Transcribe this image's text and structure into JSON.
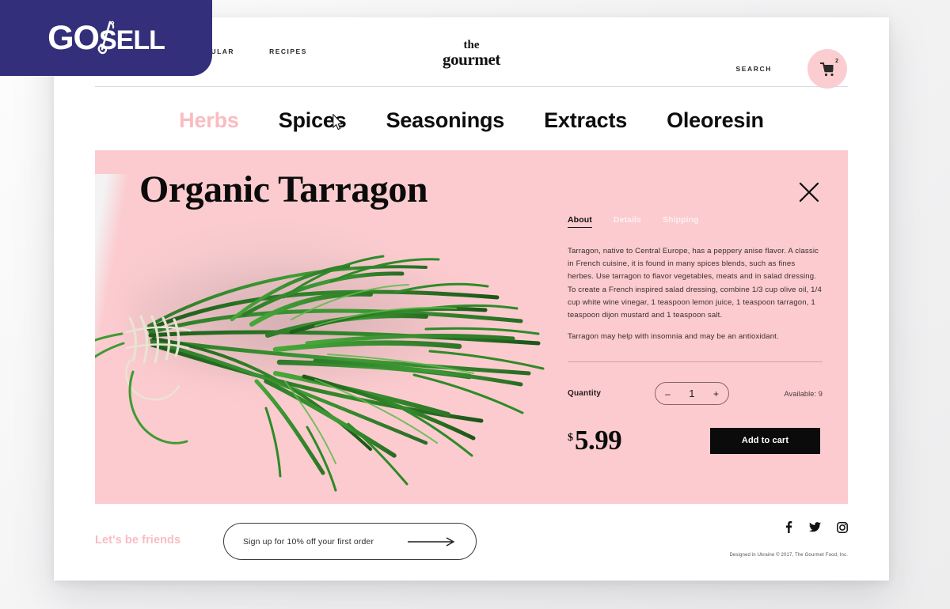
{
  "badge": {
    "text_go": "G",
    "text_o": "O",
    "text_sell": "SELL",
    "full": "GoSELL"
  },
  "header": {
    "nav_items": [
      "POPULAR",
      "RECIPES"
    ],
    "brand_line1": "the",
    "brand_line2": "gourmet",
    "search_label": "SEARCH",
    "cart_icon": "shopping-cart-icon",
    "cart_count": "2"
  },
  "categories": [
    {
      "label": "Herbs",
      "active": true
    },
    {
      "label": "Spices",
      "active": false
    },
    {
      "label": "Seasonings",
      "active": false
    },
    {
      "label": "Extracts",
      "active": false
    },
    {
      "label": "Oleoresin",
      "active": false
    }
  ],
  "product": {
    "title": "Organic Tarragon",
    "close_icon": "close-icon",
    "image_alt": "organic tarragon bunch tied with twine",
    "tabs": [
      {
        "label": "About",
        "active": true
      },
      {
        "label": "Details",
        "active": false
      },
      {
        "label": "Shipping",
        "active": false
      }
    ],
    "description_p1": "Tarragon, native to Central Europe, has a peppery anise flavor. A classic in French cuisine, it is found in many spices blends, such as fines herbes. Use tarragon to flavor vegetables, meats and in salad dressing. To create a French inspired salad dressing, combine 1/3 cup olive oil, 1/4 cup white wine vinegar, 1 teaspoon lemon juice, 1 teaspoon tarragon, 1 teaspoon dijon mustard and 1 teaspoon salt.",
    "description_p2": "Tarragon may help with insomnia and may be an antioxidant.",
    "quantity_label": "Quantity",
    "quantity_minus": "–",
    "quantity_value": "1",
    "quantity_plus": "+",
    "availability": "Available: 9",
    "price_currency": "$",
    "price_amount": "5.99",
    "add_to_cart_label": "Add to cart"
  },
  "footer": {
    "friends_label": "Let's be friends",
    "signup_text": "Sign up for 10% off your first order",
    "signup_arrow_icon": "arrow-right-icon",
    "social": [
      "facebook-icon",
      "twitter-icon",
      "instagram-icon"
    ],
    "copyright": "Designed in Ukraine © 2017, The Gourmet Food, Inc."
  },
  "colors": {
    "panel_pink": "#fbcbcf",
    "accent_pink": "#f9bcc2",
    "badge_purple": "#342f7a",
    "ink": "#0b0b0b"
  }
}
